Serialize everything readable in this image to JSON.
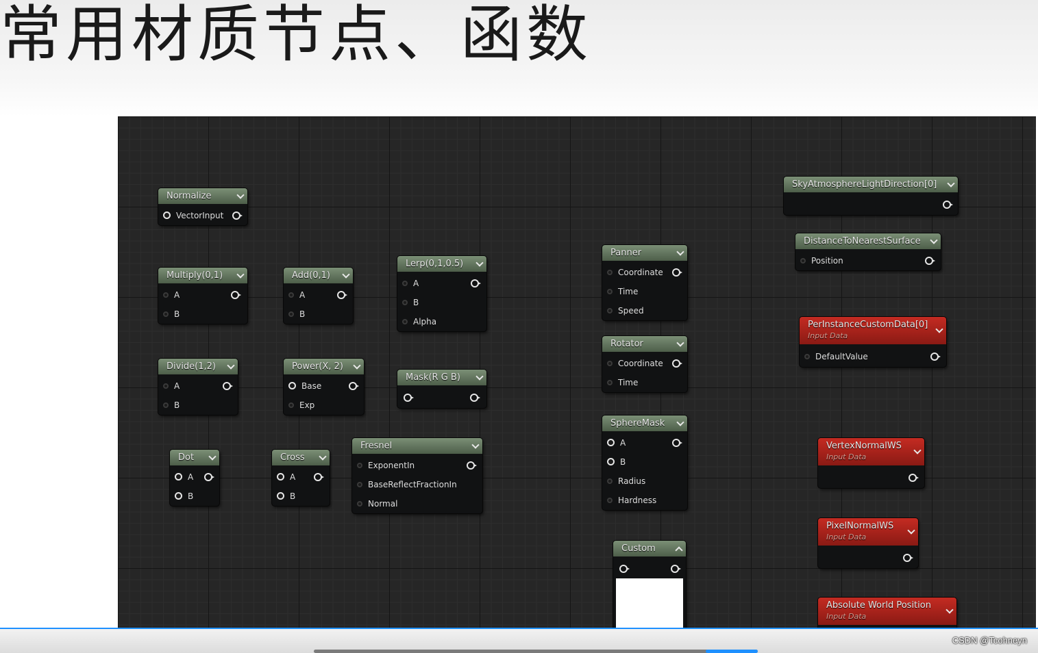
{
  "slide": {
    "title": "常用材质节点、函数"
  },
  "nodes": {
    "normalize": {
      "title": "Normalize",
      "pins": [
        "VectorInput"
      ]
    },
    "multiply": {
      "title": "Multiply(0,1)",
      "pins": [
        "A",
        "B"
      ]
    },
    "add": {
      "title": "Add(0,1)",
      "pins": [
        "A",
        "B"
      ]
    },
    "lerp": {
      "title": "Lerp(0,1,0.5)",
      "pins": [
        "A",
        "B",
        "Alpha"
      ]
    },
    "divide": {
      "title": "Divide(1,2)",
      "pins": [
        "A",
        "B"
      ]
    },
    "power": {
      "title": "Power(X, 2)",
      "pins": [
        "Base",
        "Exp"
      ]
    },
    "mask": {
      "title": "Mask(R G B)"
    },
    "dot": {
      "title": "Dot",
      "pins": [
        "A",
        "B"
      ]
    },
    "cross": {
      "title": "Cross",
      "pins": [
        "A",
        "B"
      ]
    },
    "fresnel": {
      "title": "Fresnel",
      "pins": [
        "ExponentIn",
        "BaseReflectFractionIn",
        "Normal"
      ]
    },
    "panner": {
      "title": "Panner",
      "pins": [
        "Coordinate",
        "Time",
        "Speed"
      ]
    },
    "rotator": {
      "title": "Rotator",
      "pins": [
        "Coordinate",
        "Time"
      ]
    },
    "spheremask": {
      "title": "SphereMask",
      "pins": [
        "A",
        "B",
        "Radius",
        "Hardness"
      ]
    },
    "custom": {
      "title": "Custom"
    },
    "sky": {
      "title": "SkyAtmosphereLightDirection[0]"
    },
    "distance": {
      "title": "DistanceToNearestSurface",
      "pins": [
        "Position"
      ]
    },
    "perinstance": {
      "title": "PerInstanceCustomData[0]",
      "subtitle": "Input Data",
      "pins": [
        "DefaultValue"
      ]
    },
    "vertexnormal": {
      "title": "VertexNormalWS",
      "subtitle": "Input Data"
    },
    "pixelnormal": {
      "title": "PixelNormalWS",
      "subtitle": "Input Data"
    },
    "absworld": {
      "title": "Absolute World Position",
      "subtitle": "Input Data"
    }
  },
  "watermark": "CSDN @Tcohneyn"
}
